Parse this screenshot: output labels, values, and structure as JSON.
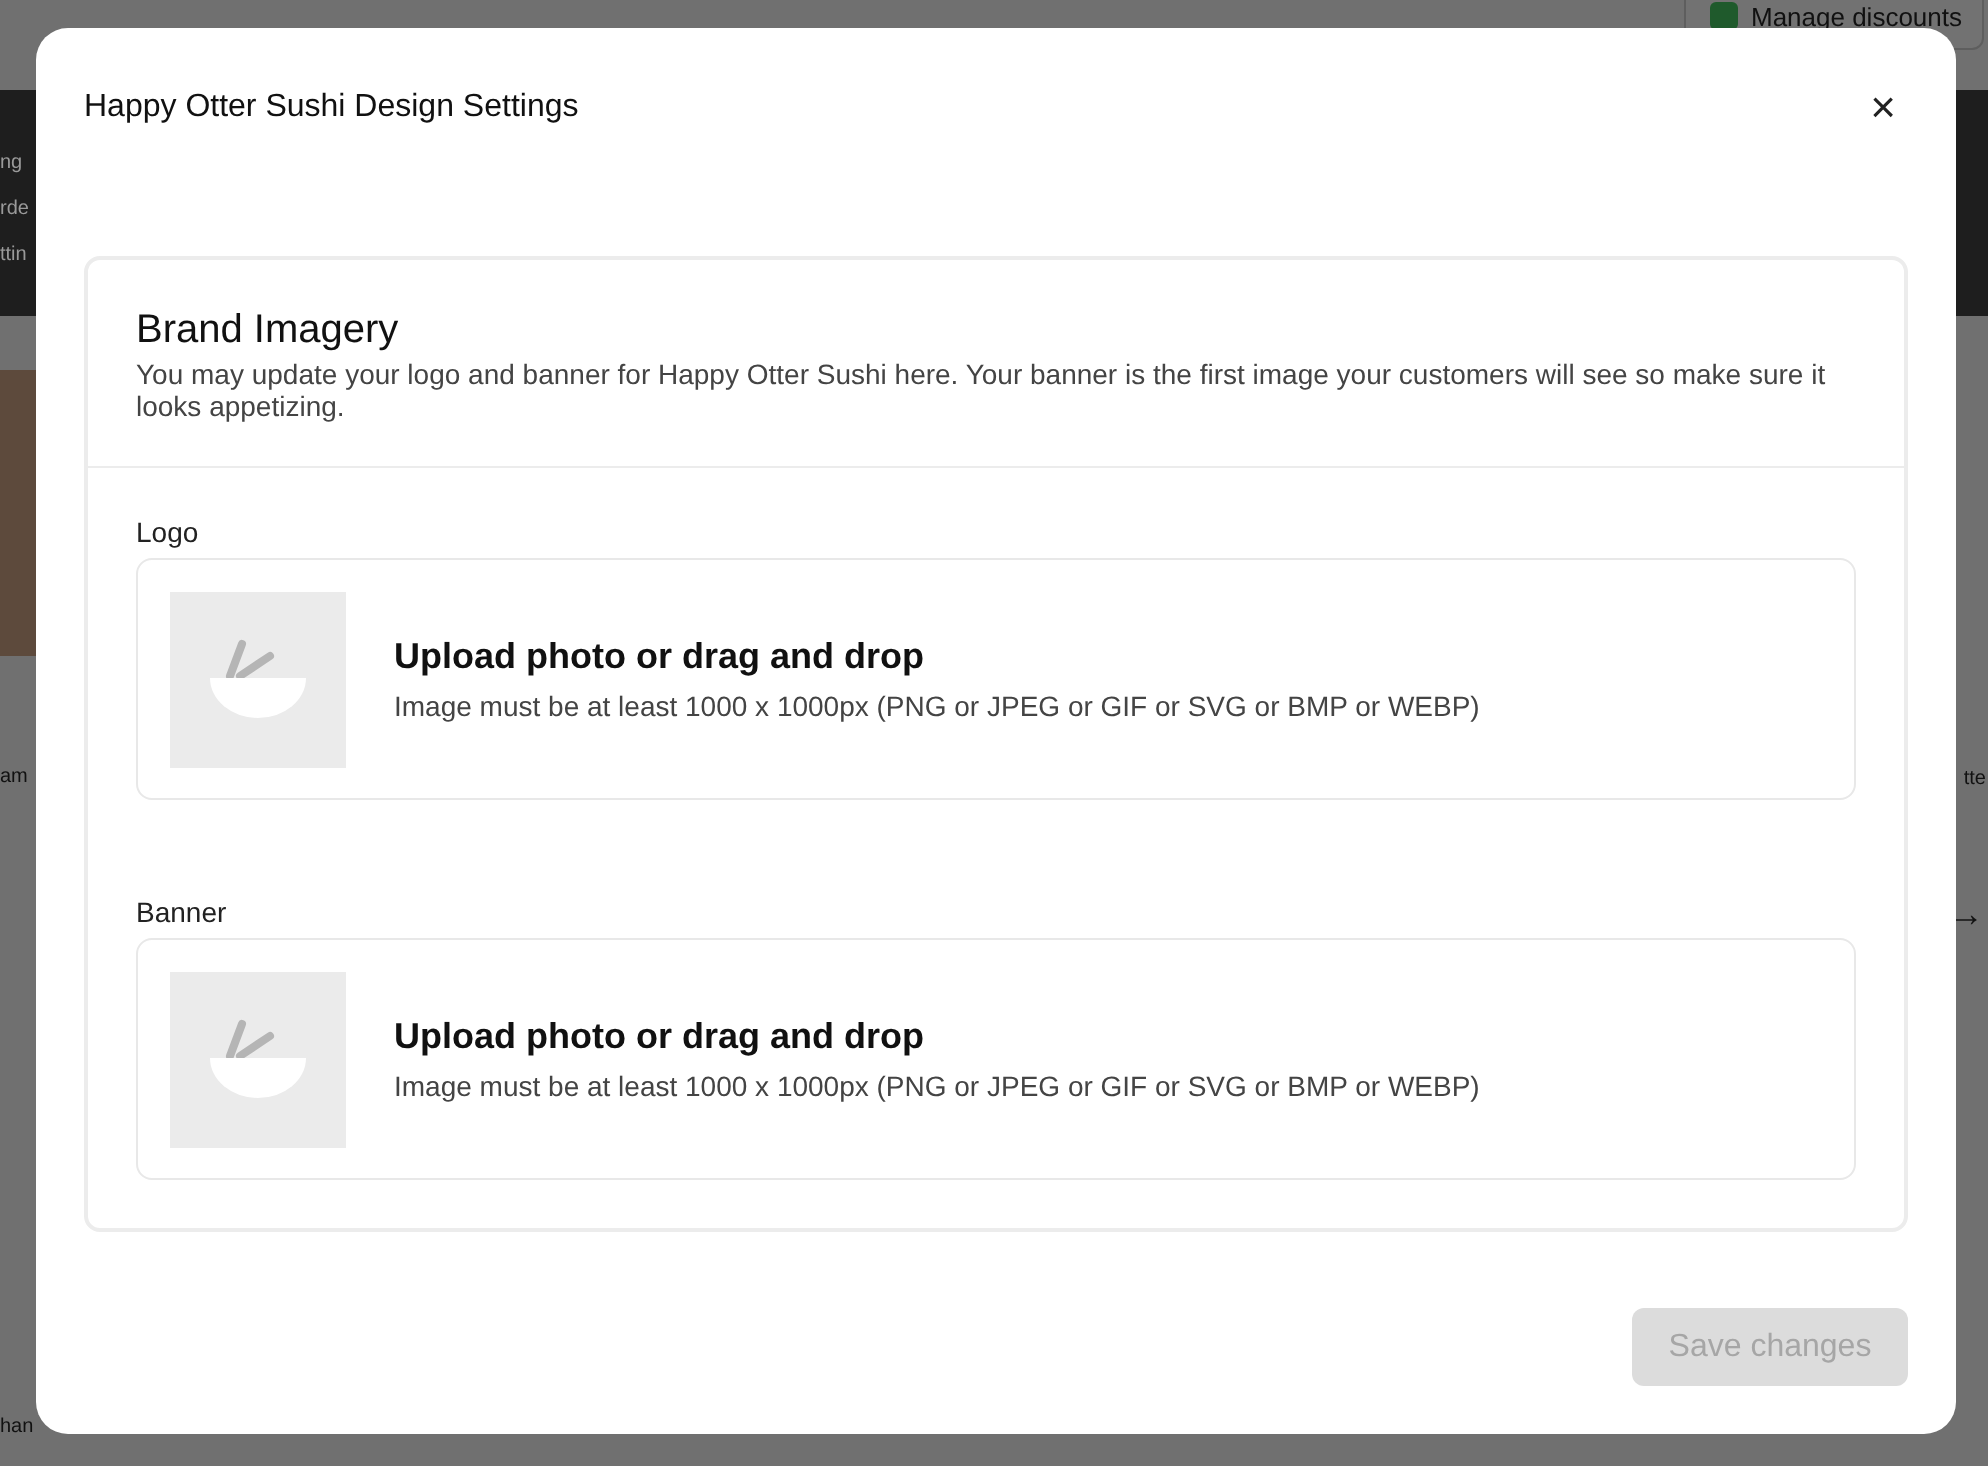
{
  "background": {
    "manage_discounts_button": "Manage discounts",
    "header_fragments": [
      "ng",
      "rde",
      "ttin"
    ],
    "left_label": "am",
    "right_label": "tte",
    "arrow": "→",
    "bottom_label": "han"
  },
  "dialog": {
    "title": "Happy Otter Sushi Design Settings",
    "close": "×",
    "section": {
      "title": "Brand Imagery",
      "description": "You may update your logo and banner for Happy Otter Sushi here. Your banner is the first image your customers will see so make sure it looks appetizing."
    },
    "uploads": [
      {
        "label": "Logo",
        "title": "Upload photo or drag and drop",
        "hint": "Image must be at least 1000 x 1000px (PNG or JPEG or GIF or SVG or BMP or WEBP)"
      },
      {
        "label": "Banner",
        "title": "Upload photo or drag and drop",
        "hint": "Image must be at least 1000 x 1000px (PNG or JPEG or GIF or SVG or BMP or WEBP)"
      }
    ],
    "save_button": {
      "label": "Save changes",
      "disabled": true
    }
  }
}
